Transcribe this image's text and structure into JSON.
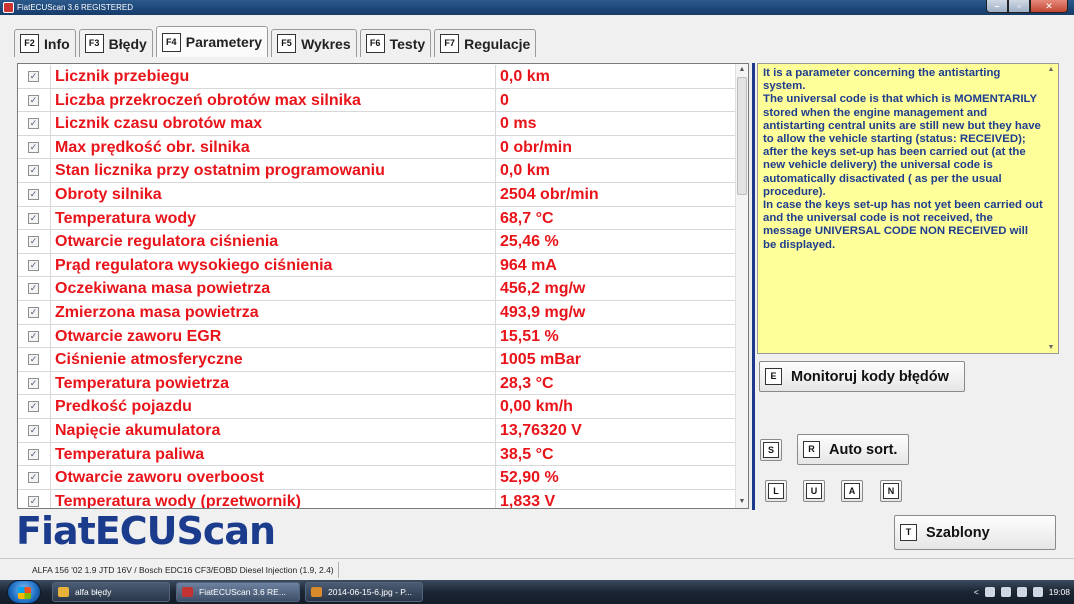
{
  "window": {
    "title": "FiatECUScan 3.6 REGISTERED",
    "controls": {
      "minimize": "–",
      "maximize": "▫",
      "close": "✕"
    }
  },
  "tabs": [
    {
      "key": "F2",
      "label": "Info",
      "active": false
    },
    {
      "key": "F3",
      "label": "Błędy",
      "active": false
    },
    {
      "key": "F4",
      "label": "Parametery",
      "active": true
    },
    {
      "key": "F5",
      "label": "Wykres",
      "active": false
    },
    {
      "key": "F6",
      "label": "Testy",
      "active": false
    },
    {
      "key": "F7",
      "label": "Regulacje",
      "active": false
    }
  ],
  "parameters": [
    {
      "checked": true,
      "name": "Licznik przebiegu",
      "value": "0,0 km"
    },
    {
      "checked": true,
      "name": "Liczba przekroczeń obrotów max silnika",
      "value": "0"
    },
    {
      "checked": true,
      "name": "Licznik czasu obrotów max",
      "value": "0 ms"
    },
    {
      "checked": true,
      "name": "Max prędkość obr. silnika",
      "value": "0 obr/min"
    },
    {
      "checked": true,
      "name": "Stan licznika przy ostatnim programowaniu",
      "value": "0,0 km"
    },
    {
      "checked": true,
      "name": "Obroty silnika",
      "value": "2504 obr/min"
    },
    {
      "checked": true,
      "name": "Temperatura wody",
      "value": "68,7 °C"
    },
    {
      "checked": true,
      "name": "Otwarcie regulatora ciśnienia",
      "value": "25,46 %"
    },
    {
      "checked": true,
      "name": "Prąd regulatora wysokiego ciśnienia",
      "value": "964 mA"
    },
    {
      "checked": true,
      "name": "Oczekiwana masa powietrza",
      "value": "456,2 mg/w"
    },
    {
      "checked": true,
      "name": "Zmierzona masa powietrza",
      "value": "493,9 mg/w"
    },
    {
      "checked": true,
      "name": "Otwarcie zaworu EGR",
      "value": "15,51 %"
    },
    {
      "checked": true,
      "name": "Ciśnienie atmosferyczne",
      "value": "1005 mBar"
    },
    {
      "checked": true,
      "name": "Temperatura powietrza",
      "value": "28,3 °C"
    },
    {
      "checked": true,
      "name": "Predkość pojazdu",
      "value": "0,00 km/h"
    },
    {
      "checked": true,
      "name": "Napięcie akumulatora",
      "value": "13,76320 V"
    },
    {
      "checked": true,
      "name": "Temperatura paliwa",
      "value": "38,5 °C"
    },
    {
      "checked": true,
      "name": "Otwarcie zaworu overboost",
      "value": "52,90 %"
    },
    {
      "checked": true,
      "name": "Temperatura wody (przetwornik)",
      "value": "1,833 V"
    }
  ],
  "description": "It is a parameter concerning the antistarting system.\nThe universal code is that which is MOMENTARILY stored when the engine management and antistarting central units are still new but they have to allow the vehicle starting (status: RECEIVED); after the keys set-up has been carried out (at the new vehicle delivery) the universal code is automatically disactivated ( as per the usual procedure).\nIn case the keys set-up has not yet been carried out and the universal code is not received, the message UNIVERSAL CODE NON RECEIVED will be displayed.",
  "buttons": {
    "monitor": {
      "key": "E",
      "label": "Monitoruj kody błędów"
    },
    "s": {
      "key": "S"
    },
    "autosort": {
      "key": "R",
      "label": "Auto sort."
    },
    "l": {
      "key": "L"
    },
    "u": {
      "key": "U"
    },
    "a": {
      "key": "A"
    },
    "n": {
      "key": "N"
    },
    "templates": {
      "key": "T",
      "label": "Szablony"
    }
  },
  "logo": "FiatECUScan",
  "status_bar": "ALFA 156 '02 1.9 JTD 16V / Bosch EDC16 CF3/EOBD Diesel Injection (1.9, 2.4)",
  "taskbar": {
    "items": [
      {
        "label": "alfa błędy",
        "active": false,
        "color": "#e8b23a"
      },
      {
        "label": "FiatECUScan 3.6 RE...",
        "active": true,
        "color": "#c33333"
      },
      {
        "label": "2014-06-15-6.jpg - P...",
        "active": false,
        "color": "#d98a2a"
      }
    ],
    "clock": "19:08",
    "tray_expand": "<"
  },
  "colors": {
    "param_text": "#e8141a",
    "description_bg": "#ffff99",
    "description_text": "#1e3d8f",
    "logo": "#1b3b8c",
    "divider": "#1f3a8a"
  }
}
